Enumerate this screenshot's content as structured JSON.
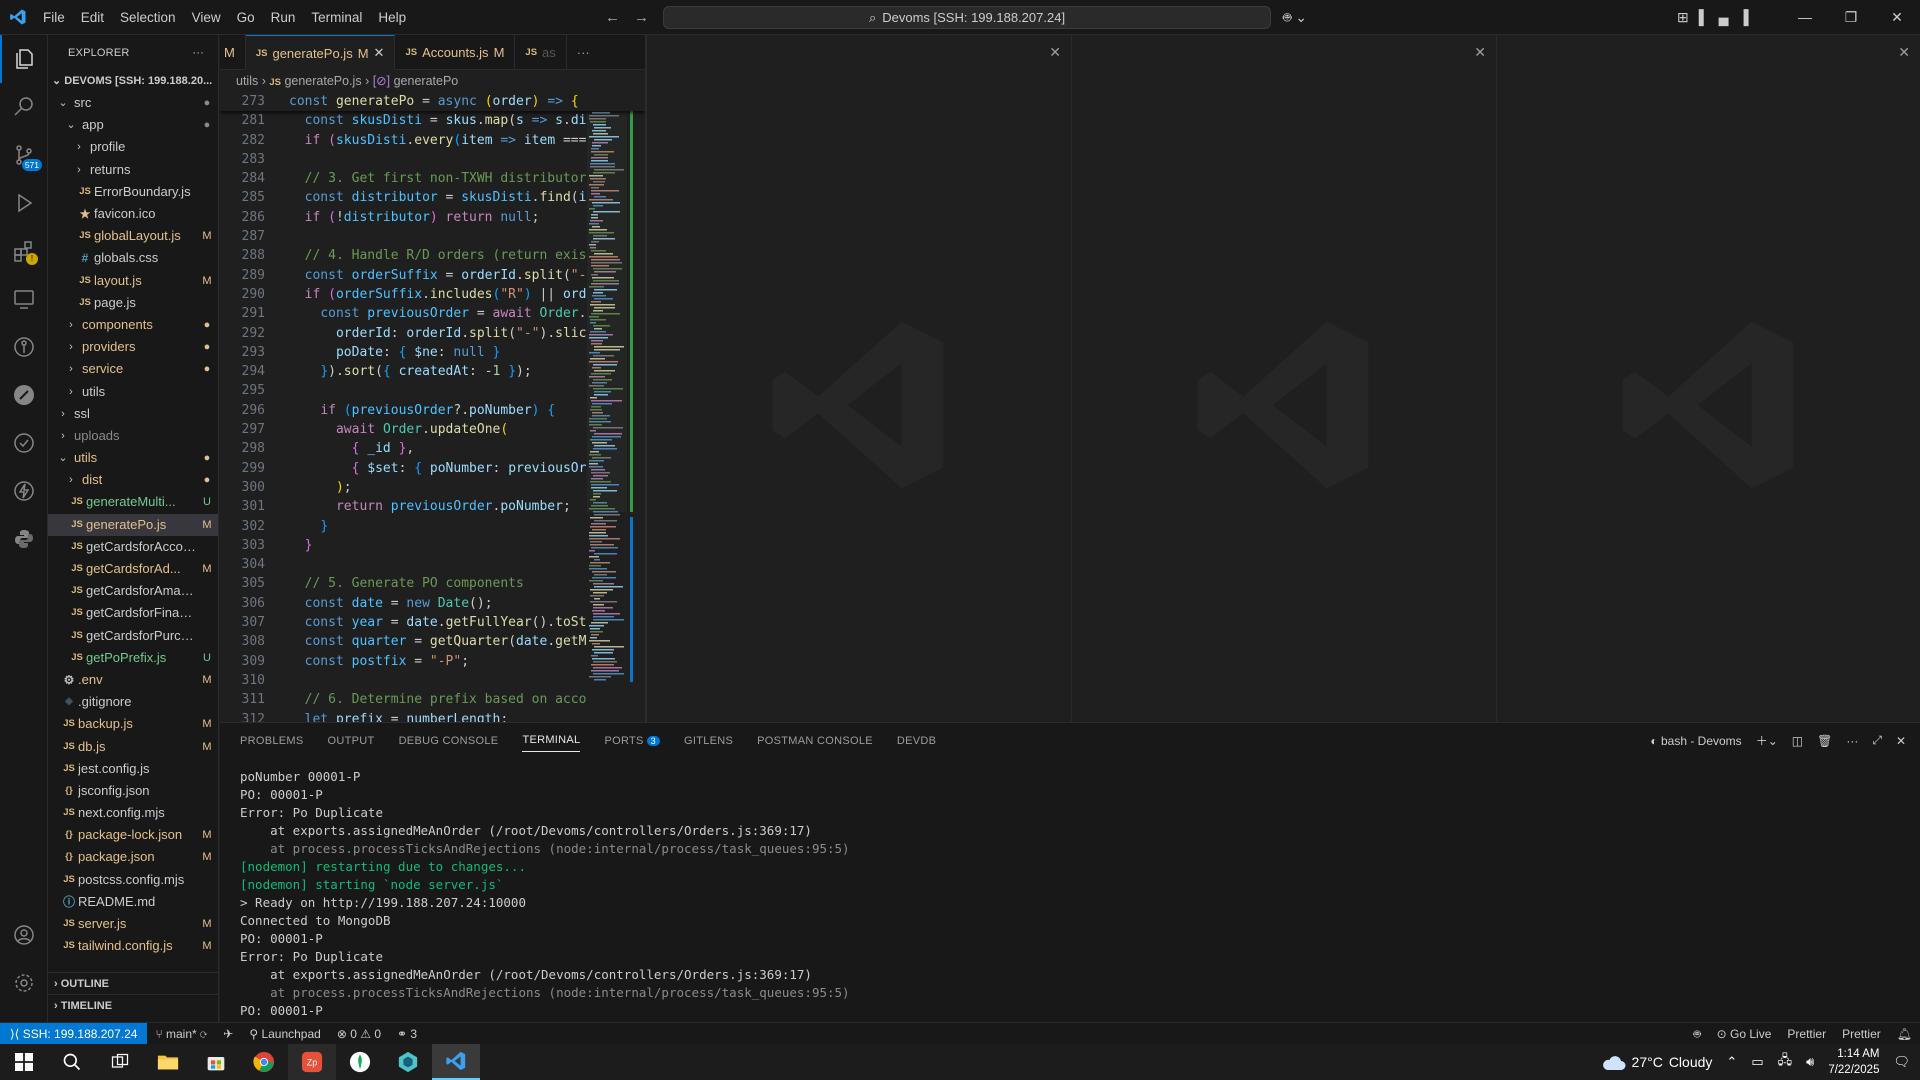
{
  "titlebar": {
    "menu": [
      "File",
      "Edit",
      "Selection",
      "View",
      "Go",
      "Run",
      "Terminal",
      "Help"
    ],
    "search_text": "Devoms [SSH: 199.188.207.24]"
  },
  "activity": {
    "source_control_badge": "571"
  },
  "explorer": {
    "title": "EXPLORER",
    "root": "DEVOMS [SSH: 199.188.20...",
    "items": [
      {
        "name": "src",
        "type": "folder-open",
        "indent": 0,
        "status": "●",
        "color": "norm"
      },
      {
        "name": "app",
        "type": "folder-open",
        "indent": 1,
        "status": "●",
        "color": "norm"
      },
      {
        "name": "profile",
        "type": "folder",
        "indent": 2,
        "status": "",
        "color": "norm"
      },
      {
        "name": "returns",
        "type": "folder",
        "indent": 2,
        "status": "",
        "color": "norm"
      },
      {
        "name": "ErrorBoundary.js",
        "type": "js",
        "indent": 2,
        "status": "",
        "color": "norm"
      },
      {
        "name": "favicon.ico",
        "type": "star",
        "indent": 2,
        "status": "",
        "color": "norm"
      },
      {
        "name": "globalLayout.js",
        "type": "js",
        "indent": 2,
        "status": "M",
        "color": "mod"
      },
      {
        "name": "globals.css",
        "type": "css",
        "indent": 2,
        "status": "",
        "color": "norm"
      },
      {
        "name": "layout.js",
        "type": "js",
        "indent": 2,
        "status": "M",
        "color": "mod"
      },
      {
        "name": "page.js",
        "type": "js",
        "indent": 2,
        "status": "",
        "color": "norm"
      },
      {
        "name": "components",
        "type": "folder",
        "indent": 1,
        "status": "●",
        "color": "mod"
      },
      {
        "name": "providers",
        "type": "folder",
        "indent": 1,
        "status": "●",
        "color": "mod"
      },
      {
        "name": "service",
        "type": "folder",
        "indent": 1,
        "status": "●",
        "color": "mod"
      },
      {
        "name": "utils",
        "type": "folder",
        "indent": 1,
        "status": "",
        "color": "norm"
      },
      {
        "name": "ssl",
        "type": "folder",
        "indent": 0,
        "status": "",
        "color": "norm"
      },
      {
        "name": "uploads",
        "type": "folder",
        "indent": 0,
        "status": "",
        "color": "dot"
      },
      {
        "name": "utils",
        "type": "folder-open",
        "indent": 0,
        "status": "●",
        "color": "mod"
      },
      {
        "name": "dist",
        "type": "folder",
        "indent": 1,
        "status": "●",
        "color": "mod"
      },
      {
        "name": "generateMulti...",
        "type": "js",
        "indent": 1,
        "status": "U",
        "color": "untr"
      },
      {
        "name": "generatePo.js",
        "type": "js",
        "indent": 1,
        "status": "M",
        "color": "mod",
        "selected": true
      },
      {
        "name": "getCardsforAccount.js",
        "type": "js",
        "indent": 1,
        "status": "",
        "color": "norm"
      },
      {
        "name": "getCardsforAd...",
        "type": "js",
        "indent": 1,
        "status": "M",
        "color": "mod"
      },
      {
        "name": "getCardsforAmazon.js",
        "type": "js",
        "indent": 1,
        "status": "",
        "color": "norm"
      },
      {
        "name": "getCardsforFinance.js",
        "type": "js",
        "indent": 1,
        "status": "",
        "color": "norm"
      },
      {
        "name": "getCardsforPurchasi...",
        "type": "js",
        "indent": 1,
        "status": "",
        "color": "norm"
      },
      {
        "name": "getPoPrefix.js",
        "type": "js",
        "indent": 1,
        "status": "U",
        "color": "untr"
      },
      {
        "name": ".env",
        "type": "gear",
        "indent": 0,
        "status": "M",
        "color": "mod"
      },
      {
        "name": ".gitignore",
        "type": "git",
        "indent": 0,
        "status": "",
        "color": "norm"
      },
      {
        "name": "backup.js",
        "type": "js",
        "indent": 0,
        "status": "M",
        "color": "mod"
      },
      {
        "name": "db.js",
        "type": "js",
        "indent": 0,
        "status": "M",
        "color": "mod"
      },
      {
        "name": "jest.config.js",
        "type": "js",
        "indent": 0,
        "status": "",
        "color": "norm"
      },
      {
        "name": "jsconfig.json",
        "type": "json",
        "indent": 0,
        "status": "",
        "color": "norm"
      },
      {
        "name": "next.config.mjs",
        "type": "js",
        "indent": 0,
        "status": "",
        "color": "norm"
      },
      {
        "name": "package-lock.json",
        "type": "json",
        "indent": 0,
        "status": "M",
        "color": "mod"
      },
      {
        "name": "package.json",
        "type": "json",
        "indent": 0,
        "status": "M",
        "color": "mod"
      },
      {
        "name": "postcss.config.mjs",
        "type": "js",
        "indent": 0,
        "status": "",
        "color": "norm"
      },
      {
        "name": "README.md",
        "type": "info",
        "indent": 0,
        "status": "",
        "color": "norm"
      },
      {
        "name": "server.js",
        "type": "js",
        "indent": 0,
        "status": "M",
        "color": "mod"
      },
      {
        "name": "tailwind.config.js",
        "type": "js",
        "indent": 0,
        "status": "M",
        "color": "mod"
      }
    ],
    "outline": "OUTLINE",
    "timeline": "TIMELINE"
  },
  "tabs": [
    {
      "label": "M",
      "prefix": "",
      "status": "",
      "active": false,
      "partial": true
    },
    {
      "label": "generatePo.js",
      "prefix": "JS",
      "status": "M",
      "active": true,
      "close": "✕"
    },
    {
      "label": "Accounts.js",
      "prefix": "JS",
      "status": "M",
      "active": false
    },
    {
      "label": "as",
      "prefix": "JS",
      "status": "",
      "active": false,
      "partial": true
    }
  ],
  "breadcrumb": {
    "folder": "utils",
    "file": "generatePo.js",
    "symbol": "generatePo"
  },
  "panel": {
    "tabs": [
      "PROBLEMS",
      "OUTPUT",
      "DEBUG CONSOLE",
      "TERMINAL",
      "PORTS",
      "GITLENS",
      "POSTMAN CONSOLE",
      "DEVDB"
    ],
    "active_tab": "TERMINAL",
    "ports_badge": "3",
    "shell": "bash - Devoms",
    "terminal_lines": [
      {
        "text": "poNumber 00001-P",
        "cls": ""
      },
      {
        "text": "PO: 00001-P",
        "cls": ""
      },
      {
        "text": "Error: Po Duplicate",
        "cls": ""
      },
      {
        "text": "    at exports.assignedMeAnOrder (/root/Devoms/controllers/Orders.js:369:17)",
        "cls": ""
      },
      {
        "text": "    at process.processTicksAndRejections (node:internal/process/task_queues:95:5)",
        "cls": "t-dim"
      },
      {
        "text": "[nodemon] restarting due to changes...",
        "cls": "t-green"
      },
      {
        "text": "[nodemon] starting `node server.js`",
        "cls": "t-green"
      },
      {
        "text": "> Ready on http://199.188.207.24:10000",
        "cls": ""
      },
      {
        "text": "Connected to MongoDB",
        "cls": ""
      },
      {
        "text": "PO: 00001-P",
        "cls": ""
      },
      {
        "text": "Error: Po Duplicate",
        "cls": ""
      },
      {
        "text": "    at exports.assignedMeAnOrder (/root/Devoms/controllers/Orders.js:369:17)",
        "cls": ""
      },
      {
        "text": "    at process.processTicksAndRejections (node:internal/process/task_queues:95:5)",
        "cls": "t-dim"
      },
      {
        "text": "PO: 00001-P",
        "cls": ""
      }
    ]
  },
  "statusbar": {
    "remote": "SSH: 199.188.207.24",
    "branch": "main*",
    "launchpad": "Launchpad",
    "errors": "0",
    "warnings": "0",
    "ports": "3",
    "golive": "Go Live",
    "prettier1": "Prettier",
    "prettier2": "Prettier"
  },
  "taskbar": {
    "weather_temp": "27°C",
    "weather_text": "Cloudy",
    "time": "1:14 AM",
    "date": "7/22/2025"
  },
  "colors": {
    "accent": "#0078d4",
    "modified": "#e2c08d",
    "untracked": "#73c991"
  }
}
